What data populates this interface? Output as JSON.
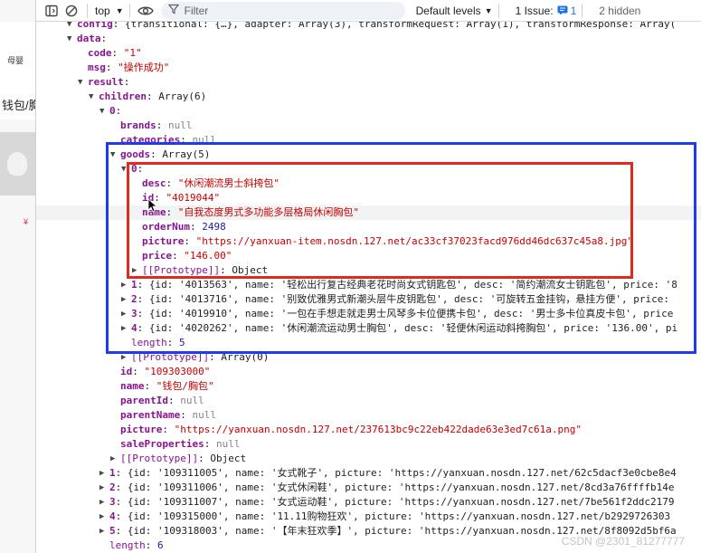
{
  "page": {
    "left_text_1": "母婴",
    "left_text_2": "钱包/胸",
    "left_price": "¥"
  },
  "toolbar": {
    "context": "top",
    "filter_placeholder": "Filter",
    "levels": "Default levels",
    "issues_label": "1 Issue:",
    "issues_count": "1",
    "hidden": "2 hidden"
  },
  "rows": [
    {
      "indent": 0,
      "arrow": "down",
      "k": "config",
      "rest": "{transitional: {…}, adapter: Array(3), transformRequest: Array(1), transformResponse: Array(",
      "rt": "plain"
    },
    {
      "indent": 0,
      "arrow": "down",
      "k": "data",
      "rest": "",
      "rt": "plain"
    },
    {
      "indent": 1,
      "arrow": "",
      "k": "code",
      "rest": "\"1\"",
      "rt": "str"
    },
    {
      "indent": 1,
      "arrow": "",
      "k": "msg",
      "rest": "\"操作成功\"",
      "rt": "str"
    },
    {
      "indent": 1,
      "arrow": "down",
      "k": "result",
      "rest": "",
      "rt": "plain"
    },
    {
      "indent": 2,
      "arrow": "down",
      "k": "children",
      "rest": "Array(6)",
      "rt": "plain"
    },
    {
      "indent": 3,
      "arrow": "down",
      "k": "0",
      "rest": "",
      "rt": "plain"
    },
    {
      "indent": 4,
      "arrow": "",
      "k": "brands",
      "rest": "null",
      "rt": "null"
    },
    {
      "indent": 4,
      "arrow": "",
      "k": "categories",
      "rest": "null",
      "rt": "null"
    },
    {
      "indent": 4,
      "arrow": "down",
      "k": "goods",
      "rest": "Array(5)",
      "rt": "plain"
    },
    {
      "indent": 5,
      "arrow": "down",
      "k": "0",
      "rest": "",
      "rt": "plain"
    },
    {
      "indent": 6,
      "arrow": "",
      "k": "desc",
      "rest": "\"休闲潮流男士斜挎包\"",
      "rt": "str"
    },
    {
      "indent": 6,
      "arrow": "",
      "k": "id",
      "rest": "\"4019044\"",
      "rt": "str"
    },
    {
      "indent": 6,
      "arrow": "",
      "k": "name",
      "rest": "\"自我态度男式多功能多层格局休闲胸包\"",
      "rt": "str",
      "hl": true
    },
    {
      "indent": 6,
      "arrow": "",
      "k": "orderNum",
      "rest": "2498",
      "rt": "num"
    },
    {
      "indent": 6,
      "arrow": "",
      "k": "picture",
      "rest": "\"https://yanxuan-item.nosdn.127.net/ac33cf37023facd976dd46dc637c45a8.jpg\"",
      "rt": "str"
    },
    {
      "indent": 6,
      "arrow": "",
      "k": "price",
      "rest": "\"146.00\"",
      "rt": "str"
    },
    {
      "indent": 6,
      "arrow": "right",
      "k": "[[Prototype]]",
      "rest": "Object",
      "rt": "plain",
      "proto": true
    },
    {
      "indent": 5,
      "arrow": "right",
      "k": "1",
      "rest": "{id: '4013563', name: '轻松出行复古经典老花时尚女式钥匙包', desc: '简约潮流女士钥匙包', price: '8",
      "rt": "plain"
    },
    {
      "indent": 5,
      "arrow": "right",
      "k": "2",
      "rest": "{id: '4013716', name: '别致优雅男式新潮头层牛皮钥匙包', desc: '可旋转五金挂钩，悬挂方便', price:",
      "rt": "plain"
    },
    {
      "indent": 5,
      "arrow": "right",
      "k": "3",
      "rest": "{id: '4019910', name: '一包在手想走就走男士风琴多卡位便携卡包', desc: '男士多卡位真皮卡包', price",
      "rt": "plain"
    },
    {
      "indent": 5,
      "arrow": "right",
      "k": "4",
      "rest": "{id: '4020262', name: '休闲潮流运动男士胸包', desc: '轻便休闲运动斜挎胸包', price: '136.00', pi",
      "rt": "plain"
    },
    {
      "indent": 5,
      "arrow": "",
      "k": "length",
      "rest": "5",
      "rt": "num",
      "plainkey": true
    },
    {
      "indent": 5,
      "arrow": "right",
      "k": "[[Prototype]]",
      "rest": "Array(0)",
      "rt": "plain",
      "proto": true
    },
    {
      "indent": 4,
      "arrow": "",
      "k": "id",
      "rest": "\"109303000\"",
      "rt": "str"
    },
    {
      "indent": 4,
      "arrow": "",
      "k": "name",
      "rest": "\"钱包/胸包\"",
      "rt": "str"
    },
    {
      "indent": 4,
      "arrow": "",
      "k": "parentId",
      "rest": "null",
      "rt": "null"
    },
    {
      "indent": 4,
      "arrow": "",
      "k": "parentName",
      "rest": "null",
      "rt": "null"
    },
    {
      "indent": 4,
      "arrow": "",
      "k": "picture",
      "rest": "\"https://yanxuan.nosdn.127.net/237613bc9c22eb422dade63e3ed7c61a.png\"",
      "rt": "str"
    },
    {
      "indent": 4,
      "arrow": "",
      "k": "saleProperties",
      "rest": "null",
      "rt": "null"
    },
    {
      "indent": 4,
      "arrow": "right",
      "k": "[[Prototype]]",
      "rest": "Object",
      "rt": "plain",
      "proto": true
    },
    {
      "indent": 3,
      "arrow": "right",
      "k": "1",
      "rest": "{id: '109311005', name: '女式靴子', picture: 'https://yanxuan.nosdn.127.net/62c5dacf3e0cbe8e4",
      "rt": "plain"
    },
    {
      "indent": 3,
      "arrow": "right",
      "k": "2",
      "rest": "{id: '109311006', name: '女式休闲鞋', picture: 'https://yanxuan.nosdn.127.net/8cd3a76ffffb14e",
      "rt": "plain"
    },
    {
      "indent": 3,
      "arrow": "right",
      "k": "3",
      "rest": "{id: '109311007', name: '女式运动鞋', picture: 'https://yanxuan.nosdn.127.net/7be561f2ddc2179",
      "rt": "plain"
    },
    {
      "indent": 3,
      "arrow": "right",
      "k": "4",
      "rest": "{id: '109315000', name: '11.11购物狂欢', picture: 'https://yanxuan.nosdn.127.net/b2929726303",
      "rt": "plain"
    },
    {
      "indent": 3,
      "arrow": "right",
      "k": "5",
      "rest": "{id: '109318003', name: '【年末狂欢季】', picture: 'https://yanxuan.nosdn.127.net/8f8092d5bf6a",
      "rt": "plain"
    },
    {
      "indent": 3,
      "arrow": "",
      "k": "length",
      "rest": "6",
      "rt": "num",
      "plainkey": true
    }
  ],
  "watermark": "CSDN @2301_81277777",
  "colors": {
    "annotation_blue": "#1f3bf0",
    "annotation_red": "#e02b1c",
    "string": "#c80000",
    "key": "#881391",
    "number": "#1a1aa6"
  }
}
